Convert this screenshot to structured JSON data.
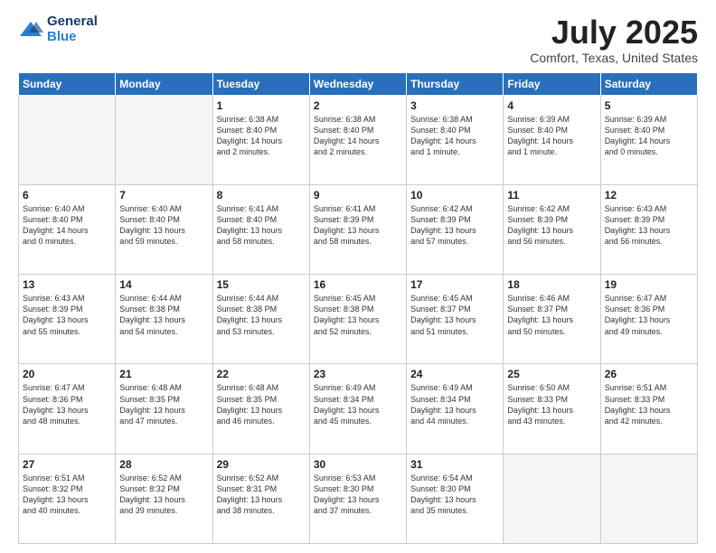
{
  "header": {
    "logo_line1": "General",
    "logo_line2": "Blue",
    "month_title": "July 2025",
    "location": "Comfort, Texas, United States"
  },
  "days_of_week": [
    "Sunday",
    "Monday",
    "Tuesday",
    "Wednesday",
    "Thursday",
    "Friday",
    "Saturday"
  ],
  "weeks": [
    [
      {
        "day": "",
        "content": ""
      },
      {
        "day": "",
        "content": ""
      },
      {
        "day": "1",
        "content": "Sunrise: 6:38 AM\nSunset: 8:40 PM\nDaylight: 14 hours\nand 2 minutes."
      },
      {
        "day": "2",
        "content": "Sunrise: 6:38 AM\nSunset: 8:40 PM\nDaylight: 14 hours\nand 2 minutes."
      },
      {
        "day": "3",
        "content": "Sunrise: 6:38 AM\nSunset: 8:40 PM\nDaylight: 14 hours\nand 1 minute."
      },
      {
        "day": "4",
        "content": "Sunrise: 6:39 AM\nSunset: 8:40 PM\nDaylight: 14 hours\nand 1 minute."
      },
      {
        "day": "5",
        "content": "Sunrise: 6:39 AM\nSunset: 8:40 PM\nDaylight: 14 hours\nand 0 minutes."
      }
    ],
    [
      {
        "day": "6",
        "content": "Sunrise: 6:40 AM\nSunset: 8:40 PM\nDaylight: 14 hours\nand 0 minutes."
      },
      {
        "day": "7",
        "content": "Sunrise: 6:40 AM\nSunset: 8:40 PM\nDaylight: 13 hours\nand 59 minutes."
      },
      {
        "day": "8",
        "content": "Sunrise: 6:41 AM\nSunset: 8:40 PM\nDaylight: 13 hours\nand 58 minutes."
      },
      {
        "day": "9",
        "content": "Sunrise: 6:41 AM\nSunset: 8:39 PM\nDaylight: 13 hours\nand 58 minutes."
      },
      {
        "day": "10",
        "content": "Sunrise: 6:42 AM\nSunset: 8:39 PM\nDaylight: 13 hours\nand 57 minutes."
      },
      {
        "day": "11",
        "content": "Sunrise: 6:42 AM\nSunset: 8:39 PM\nDaylight: 13 hours\nand 56 minutes."
      },
      {
        "day": "12",
        "content": "Sunrise: 6:43 AM\nSunset: 8:39 PM\nDaylight: 13 hours\nand 56 minutes."
      }
    ],
    [
      {
        "day": "13",
        "content": "Sunrise: 6:43 AM\nSunset: 8:39 PM\nDaylight: 13 hours\nand 55 minutes."
      },
      {
        "day": "14",
        "content": "Sunrise: 6:44 AM\nSunset: 8:38 PM\nDaylight: 13 hours\nand 54 minutes."
      },
      {
        "day": "15",
        "content": "Sunrise: 6:44 AM\nSunset: 8:38 PM\nDaylight: 13 hours\nand 53 minutes."
      },
      {
        "day": "16",
        "content": "Sunrise: 6:45 AM\nSunset: 8:38 PM\nDaylight: 13 hours\nand 52 minutes."
      },
      {
        "day": "17",
        "content": "Sunrise: 6:45 AM\nSunset: 8:37 PM\nDaylight: 13 hours\nand 51 minutes."
      },
      {
        "day": "18",
        "content": "Sunrise: 6:46 AM\nSunset: 8:37 PM\nDaylight: 13 hours\nand 50 minutes."
      },
      {
        "day": "19",
        "content": "Sunrise: 6:47 AM\nSunset: 8:36 PM\nDaylight: 13 hours\nand 49 minutes."
      }
    ],
    [
      {
        "day": "20",
        "content": "Sunrise: 6:47 AM\nSunset: 8:36 PM\nDaylight: 13 hours\nand 48 minutes."
      },
      {
        "day": "21",
        "content": "Sunrise: 6:48 AM\nSunset: 8:35 PM\nDaylight: 13 hours\nand 47 minutes."
      },
      {
        "day": "22",
        "content": "Sunrise: 6:48 AM\nSunset: 8:35 PM\nDaylight: 13 hours\nand 46 minutes."
      },
      {
        "day": "23",
        "content": "Sunrise: 6:49 AM\nSunset: 8:34 PM\nDaylight: 13 hours\nand 45 minutes."
      },
      {
        "day": "24",
        "content": "Sunrise: 6:49 AM\nSunset: 8:34 PM\nDaylight: 13 hours\nand 44 minutes."
      },
      {
        "day": "25",
        "content": "Sunrise: 6:50 AM\nSunset: 8:33 PM\nDaylight: 13 hours\nand 43 minutes."
      },
      {
        "day": "26",
        "content": "Sunrise: 6:51 AM\nSunset: 8:33 PM\nDaylight: 13 hours\nand 42 minutes."
      }
    ],
    [
      {
        "day": "27",
        "content": "Sunrise: 6:51 AM\nSunset: 8:32 PM\nDaylight: 13 hours\nand 40 minutes."
      },
      {
        "day": "28",
        "content": "Sunrise: 6:52 AM\nSunset: 8:32 PM\nDaylight: 13 hours\nand 39 minutes."
      },
      {
        "day": "29",
        "content": "Sunrise: 6:52 AM\nSunset: 8:31 PM\nDaylight: 13 hours\nand 38 minutes."
      },
      {
        "day": "30",
        "content": "Sunrise: 6:53 AM\nSunset: 8:30 PM\nDaylight: 13 hours\nand 37 minutes."
      },
      {
        "day": "31",
        "content": "Sunrise: 6:54 AM\nSunset: 8:30 PM\nDaylight: 13 hours\nand 35 minutes."
      },
      {
        "day": "",
        "content": ""
      },
      {
        "day": "",
        "content": ""
      }
    ]
  ]
}
